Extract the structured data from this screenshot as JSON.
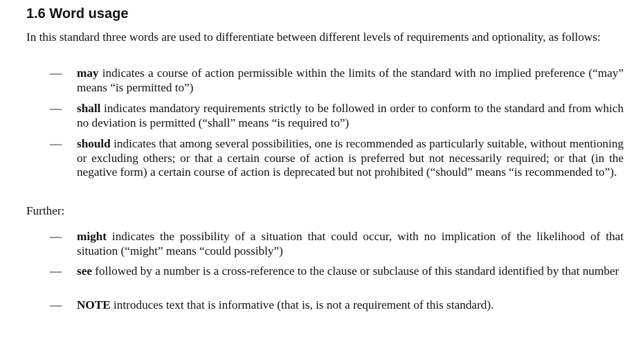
{
  "section": {
    "heading": "1.6 Word usage",
    "intro": "In this standard three words are used to differentiate between different levels of requirements and optionality, as follows:",
    "dash": "—",
    "items": [
      {
        "term": "may",
        "text": " indicates a course of action permissible within the limits of the standard with no implied preference (“may” means “is permitted to”)"
      },
      {
        "term": "shall",
        "text": " indicates mandatory requirements strictly to be followed in order to conform to the standard and from which no deviation is permitted (“shall” means “is required to”)"
      },
      {
        "term": "should",
        "text": " indicates that among several possibilities, one is recommended as particularly suitable, without mentioning or excluding others; or that a certain course of action is preferred but not necessarily required; or that (in the negative form) a certain course of action is deprecated but not prohibited (“should” means “is recommended to”)."
      }
    ],
    "further_label": "Further:",
    "further_items": [
      {
        "term": "might",
        "text": " indicates the possibility of a situation that could occur, with no implication of the likelihood of that situation (“might” means “could possibly”)"
      },
      {
        "term": "see",
        "text": " followed by a number is a cross-reference to the clause or subclause of this standard identified by that number"
      },
      {
        "term": "NOTE",
        "text": " introduces text that is informative (that is, is not a requirement of this standard)."
      }
    ]
  }
}
